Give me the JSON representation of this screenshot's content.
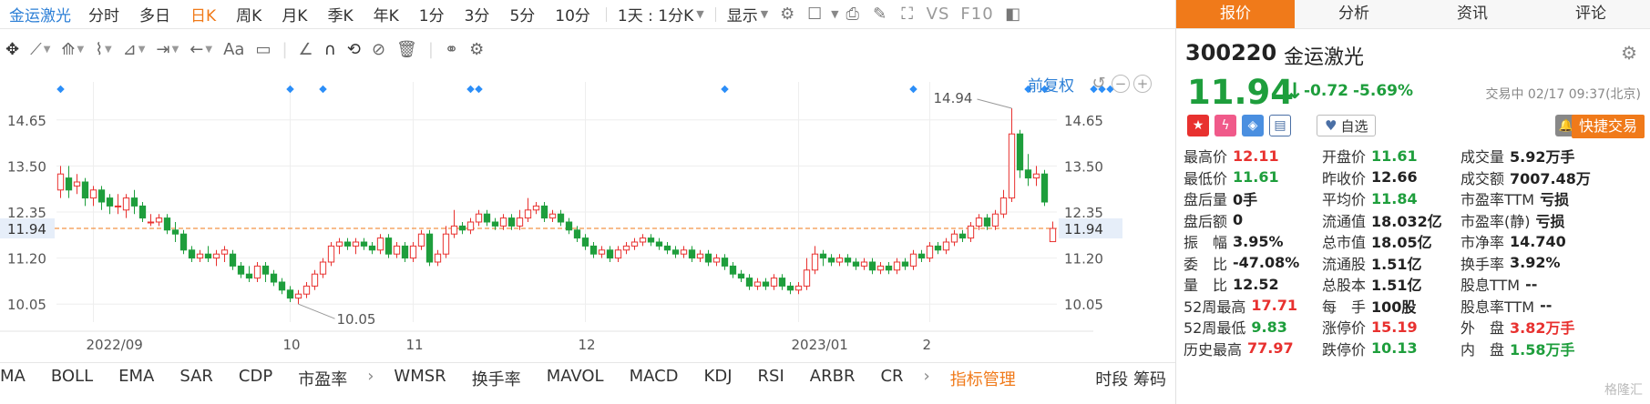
{
  "topbar": {
    "stock_name": "金运激光",
    "periods": [
      "分时",
      "多日",
      "日K",
      "周K",
      "月K",
      "季K",
      "年K",
      "1分",
      "3分",
      "5分",
      "10分"
    ],
    "active_period": "日K",
    "interval_select": "1天 : 1分K",
    "display_label": "显示",
    "vs_label": "VS",
    "f10_label": "F10"
  },
  "indicators": [
    "MA",
    "BOLL",
    "EMA",
    "SAR",
    "CDP",
    "市盈率",
    "WMSR",
    "换手率",
    "MAVOL",
    "MACD",
    "KDJ",
    "RSI",
    "ARBR",
    "CR"
  ],
  "indicator_manage": "指标管理",
  "timeframe_labels": "时段 筹码",
  "chart_controls": {
    "adjust_label": "前复权"
  },
  "chart_data": {
    "type": "candlestick",
    "x_ticks": [
      "2022/09",
      "10",
      "11",
      "12",
      "2023/01",
      "2"
    ],
    "y_ticks": [
      14.65,
      13.5,
      12.35,
      11.2,
      10.05
    ],
    "ylim": [
      9.6,
      15.6
    ],
    "current_price_line": 11.94,
    "annotations": [
      {
        "label": "14.94",
        "value": 14.94
      },
      {
        "label": "10.05",
        "value": 10.05
      }
    ],
    "candles": [
      [
        12.9,
        13.3,
        13.5,
        12.7
      ],
      [
        13.2,
        12.9,
        13.5,
        12.7
      ],
      [
        13.0,
        13.1,
        13.3,
        12.8
      ],
      [
        13.1,
        12.7,
        13.2,
        12.5
      ],
      [
        12.7,
        12.9,
        13.0,
        12.5
      ],
      [
        12.9,
        12.6,
        13.0,
        12.4
      ],
      [
        12.7,
        12.5,
        12.8,
        12.3
      ],
      [
        12.5,
        12.5,
        12.8,
        12.3
      ],
      [
        12.4,
        12.7,
        12.8,
        12.2
      ],
      [
        12.7,
        12.5,
        12.9,
        12.3
      ],
      [
        12.5,
        12.2,
        12.6,
        12.1
      ],
      [
        12.1,
        12.1,
        12.3,
        12.0
      ],
      [
        12.1,
        12.2,
        12.3,
        12.0
      ],
      [
        12.2,
        11.9,
        12.3,
        11.8
      ],
      [
        11.9,
        11.8,
        12.1,
        11.6
      ],
      [
        11.8,
        11.4,
        11.9,
        11.3
      ],
      [
        11.4,
        11.2,
        11.5,
        11.1
      ],
      [
        11.2,
        11.3,
        11.4,
        11.1
      ],
      [
        11.3,
        11.2,
        11.5,
        11.1
      ],
      [
        11.2,
        11.3,
        11.4,
        11.0
      ],
      [
        11.3,
        11.4,
        11.5,
        11.1
      ],
      [
        11.3,
        11.0,
        11.4,
        10.9
      ],
      [
        11.0,
        10.8,
        11.1,
        10.7
      ],
      [
        10.8,
        10.7,
        11.0,
        10.6
      ],
      [
        10.7,
        11.0,
        11.1,
        10.6
      ],
      [
        11.0,
        10.8,
        11.1,
        10.6
      ],
      [
        10.8,
        10.6,
        10.9,
        10.5
      ],
      [
        10.6,
        10.4,
        10.7,
        10.3
      ],
      [
        10.4,
        10.2,
        10.5,
        10.1
      ],
      [
        10.2,
        10.3,
        10.4,
        10.05
      ],
      [
        10.3,
        10.5,
        10.6,
        10.2
      ],
      [
        10.5,
        10.8,
        10.9,
        10.4
      ],
      [
        10.8,
        11.1,
        11.2,
        10.7
      ],
      [
        11.1,
        11.5,
        11.6,
        11.0
      ],
      [
        11.5,
        11.6,
        11.7,
        11.3
      ],
      [
        11.6,
        11.5,
        11.7,
        11.4
      ],
      [
        11.5,
        11.6,
        11.7,
        11.3
      ],
      [
        11.6,
        11.5,
        11.7,
        11.4
      ],
      [
        11.5,
        11.4,
        11.6,
        11.3
      ],
      [
        11.4,
        11.7,
        11.8,
        11.3
      ],
      [
        11.7,
        11.3,
        11.8,
        11.2
      ],
      [
        11.3,
        11.5,
        11.6,
        11.2
      ],
      [
        11.5,
        11.2,
        11.6,
        11.1
      ],
      [
        11.2,
        11.5,
        11.6,
        11.1
      ],
      [
        11.5,
        11.8,
        11.9,
        11.4
      ],
      [
        11.8,
        11.1,
        11.9,
        11.0
      ],
      [
        11.1,
        11.3,
        11.4,
        11.0
      ],
      [
        11.3,
        11.8,
        12.0,
        11.2
      ],
      [
        11.8,
        12.0,
        12.4,
        11.7
      ],
      [
        12.0,
        11.9,
        12.1,
        11.8
      ],
      [
        11.9,
        12.1,
        12.2,
        11.8
      ],
      [
        12.1,
        12.3,
        12.4,
        12.0
      ],
      [
        12.3,
        12.1,
        12.4,
        12.0
      ],
      [
        12.1,
        12.0,
        12.2,
        11.9
      ],
      [
        12.0,
        12.2,
        12.3,
        11.9
      ],
      [
        12.2,
        12.0,
        12.3,
        11.9
      ],
      [
        12.0,
        12.2,
        12.4,
        11.9
      ],
      [
        12.2,
        12.4,
        12.7,
        12.1
      ],
      [
        12.4,
        12.5,
        12.6,
        12.3
      ],
      [
        12.5,
        12.2,
        12.6,
        12.1
      ],
      [
        12.2,
        12.3,
        12.4,
        12.1
      ],
      [
        12.3,
        12.1,
        12.4,
        12.0
      ],
      [
        12.1,
        11.9,
        12.2,
        11.8
      ],
      [
        11.9,
        11.7,
        12.0,
        11.6
      ],
      [
        11.7,
        11.5,
        11.8,
        11.4
      ],
      [
        11.5,
        11.3,
        11.6,
        11.2
      ],
      [
        11.3,
        11.4,
        11.5,
        11.2
      ],
      [
        11.4,
        11.2,
        11.5,
        11.1
      ],
      [
        11.2,
        11.4,
        11.5,
        11.1
      ],
      [
        11.4,
        11.5,
        11.6,
        11.3
      ],
      [
        11.5,
        11.6,
        11.7,
        11.4
      ],
      [
        11.6,
        11.7,
        11.8,
        11.5
      ],
      [
        11.7,
        11.6,
        11.8,
        11.5
      ],
      [
        11.6,
        11.5,
        11.7,
        11.4
      ],
      [
        11.5,
        11.4,
        11.6,
        11.3
      ],
      [
        11.4,
        11.3,
        11.5,
        11.2
      ],
      [
        11.3,
        11.4,
        11.5,
        11.2
      ],
      [
        11.4,
        11.2,
        11.5,
        11.1
      ],
      [
        11.2,
        11.3,
        11.4,
        11.1
      ],
      [
        11.3,
        11.1,
        11.4,
        11.0
      ],
      [
        11.1,
        11.2,
        11.3,
        11.0
      ],
      [
        11.2,
        11.0,
        11.3,
        10.9
      ],
      [
        11.0,
        10.8,
        11.1,
        10.7
      ],
      [
        10.8,
        10.7,
        10.9,
        10.6
      ],
      [
        10.7,
        10.5,
        10.8,
        10.4
      ],
      [
        10.5,
        10.6,
        10.7,
        10.4
      ],
      [
        10.6,
        10.5,
        10.7,
        10.4
      ],
      [
        10.5,
        10.7,
        10.8,
        10.4
      ],
      [
        10.7,
        10.5,
        10.8,
        10.4
      ],
      [
        10.5,
        10.4,
        10.6,
        10.3
      ],
      [
        10.4,
        10.5,
        10.6,
        10.3
      ],
      [
        10.5,
        10.9,
        11.2,
        10.4
      ],
      [
        10.9,
        11.3,
        11.5,
        10.8
      ],
      [
        11.3,
        11.2,
        11.4,
        11.0
      ],
      [
        11.2,
        11.1,
        11.3,
        11.0
      ],
      [
        11.1,
        11.2,
        11.3,
        11.0
      ],
      [
        11.2,
        11.1,
        11.3,
        11.0
      ],
      [
        11.1,
        11.0,
        11.2,
        10.9
      ],
      [
        11.0,
        11.1,
        11.2,
        10.9
      ],
      [
        11.1,
        10.9,
        11.2,
        10.8
      ],
      [
        10.9,
        11.0,
        11.1,
        10.8
      ],
      [
        11.0,
        10.9,
        11.1,
        10.8
      ],
      [
        10.9,
        11.1,
        11.2,
        10.8
      ],
      [
        11.1,
        11.0,
        11.2,
        10.9
      ],
      [
        11.0,
        11.3,
        11.4,
        10.9
      ],
      [
        11.3,
        11.2,
        11.4,
        11.1
      ],
      [
        11.2,
        11.5,
        11.6,
        11.1
      ],
      [
        11.5,
        11.4,
        11.6,
        11.3
      ],
      [
        11.4,
        11.6,
        11.7,
        11.3
      ],
      [
        11.6,
        11.8,
        11.9,
        11.5
      ],
      [
        11.8,
        11.7,
        11.9,
        11.6
      ],
      [
        11.7,
        12.0,
        12.1,
        11.6
      ],
      [
        12.0,
        12.2,
        12.3,
        11.9
      ],
      [
        12.2,
        12.0,
        12.3,
        11.9
      ],
      [
        12.0,
        12.3,
        12.4,
        11.9
      ],
      [
        12.3,
        12.7,
        12.9,
        12.2
      ],
      [
        12.7,
        14.3,
        14.94,
        12.6
      ],
      [
        14.3,
        13.4,
        14.4,
        13.2
      ],
      [
        13.4,
        13.2,
        13.8,
        13.0
      ],
      [
        13.2,
        13.3,
        13.5,
        13.0
      ],
      [
        13.3,
        12.6,
        13.4,
        12.5
      ],
      [
        11.61,
        11.94,
        12.11,
        11.61
      ]
    ]
  },
  "panel": {
    "tabs": [
      "报价",
      "分析",
      "资讯",
      "评论"
    ],
    "active_tab": "报价",
    "code": "300220",
    "name": "金运激光",
    "price": "11.94",
    "change": "-0.72",
    "change_pct": "-5.69%",
    "status": "交易中 02/17 09:37(北京)",
    "watch_label": "自选",
    "trade_label": "快捷交易",
    "fields": [
      [
        {
          "label": "最高价",
          "value": "12.11",
          "color": "red"
        },
        {
          "label": "最低价",
          "value": "11.61",
          "color": "green"
        },
        {
          "label": "盘后量",
          "value": "0手",
          "color": "blk"
        },
        {
          "label": "盘后额",
          "value": "0",
          "color": "blk"
        },
        {
          "label": "振　幅",
          "value": "3.95%",
          "color": "blk"
        },
        {
          "label": "委　比",
          "value": "-47.08%",
          "color": "blk"
        },
        {
          "label": "量　比",
          "value": "12.52",
          "color": "blk"
        },
        {
          "label": "52周最高",
          "value": "17.71",
          "color": "red"
        },
        {
          "label": "52周最低",
          "value": "9.83",
          "color": "green"
        },
        {
          "label": "历史最高",
          "value": "77.97",
          "color": "red"
        }
      ],
      [
        {
          "label": "开盘价",
          "value": "11.61",
          "color": "green"
        },
        {
          "label": "昨收价",
          "value": "12.66",
          "color": "blk"
        },
        {
          "label": "平均价",
          "value": "11.84",
          "color": "green"
        },
        {
          "label": "流通值",
          "value": "18.032亿",
          "color": "blk"
        },
        {
          "label": "总市值",
          "value": "18.05亿",
          "color": "blk"
        },
        {
          "label": "流通股",
          "value": "1.51亿",
          "color": "blk"
        },
        {
          "label": "总股本",
          "value": "1.51亿",
          "color": "blk"
        },
        {
          "label": "每　手",
          "value": "100股",
          "color": "blk"
        },
        {
          "label": "涨停价",
          "value": "15.19",
          "color": "red"
        },
        {
          "label": "跌停价",
          "value": "10.13",
          "color": "green"
        }
      ],
      [
        {
          "label": "成交量",
          "value": "5.92万手",
          "color": "blk"
        },
        {
          "label": "成交额",
          "value": "7007.48万",
          "color": "blk"
        },
        {
          "label": "市盈率TTM",
          "value": "亏损",
          "color": "blk"
        },
        {
          "label": "市盈率(静)",
          "value": "亏损",
          "color": "blk"
        },
        {
          "label": "市净率",
          "value": "14.740",
          "color": "blk"
        },
        {
          "label": "换手率",
          "value": "3.92%",
          "color": "blk"
        },
        {
          "label": "股息TTM",
          "value": "--",
          "color": "blk"
        },
        {
          "label": "股息率TTM",
          "value": "--",
          "color": "blk"
        },
        {
          "label": "外　盘",
          "value": "3.82万手",
          "color": "red"
        },
        {
          "label": "内　盘",
          "value": "1.58万手",
          "color": "green"
        }
      ]
    ],
    "watermark": "格隆汇"
  }
}
